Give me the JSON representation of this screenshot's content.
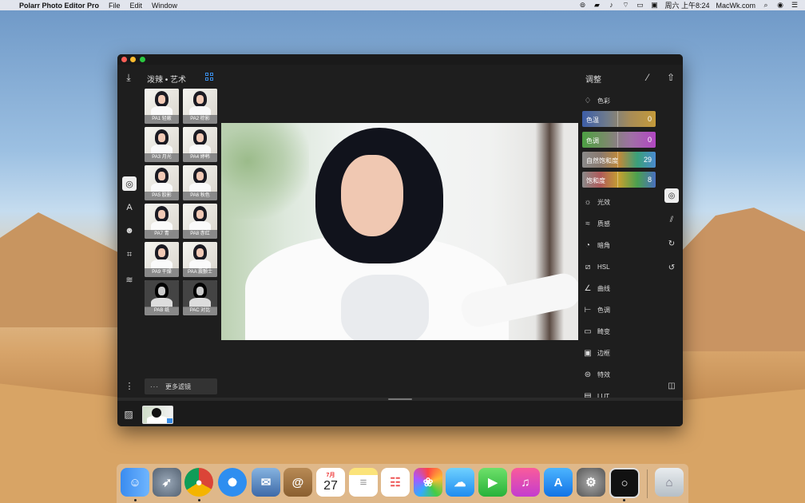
{
  "menubar": {
    "app_name": "Polarr Photo Editor Pro",
    "menus": [
      "File",
      "Edit",
      "Window"
    ],
    "clock": "周六 上午8:24",
    "site": "MacWk.com"
  },
  "toolbar": {
    "section_title": "泼辣 • 艺术",
    "adjust_title": "调整"
  },
  "filters": [
    {
      "label": "PA1 轻蔽"
    },
    {
      "label": "PA2 棕影"
    },
    {
      "label": "PA3 月光"
    },
    {
      "label": "PA4 婷韩"
    },
    {
      "label": "PA5 胶影"
    },
    {
      "label": "PA6 秋色"
    },
    {
      "label": "PA7 青"
    },
    {
      "label": "PA8 赤红"
    },
    {
      "label": "PA9 干燥"
    },
    {
      "label": "PAA 震颤士"
    },
    {
      "label": "PAB 纸"
    },
    {
      "label": "PAC 对比"
    }
  ],
  "more_filters": "更多滤镜",
  "adjust": {
    "color_section": "色彩",
    "sliders": [
      {
        "name": "色温",
        "value": "0"
      },
      {
        "name": "色调",
        "value": "0"
      },
      {
        "name": "自然饱和度",
        "value": "29"
      },
      {
        "name": "饱和度",
        "value": "8"
      }
    ],
    "categories": [
      {
        "label": "光效"
      },
      {
        "label": "质感"
      },
      {
        "label": "暗角"
      },
      {
        "label": "HSL"
      },
      {
        "label": "曲线"
      },
      {
        "label": "色调"
      },
      {
        "label": "畸变"
      },
      {
        "label": "边框"
      },
      {
        "label": "特效"
      },
      {
        "label": "LUT"
      }
    ]
  },
  "dock": {
    "calendar_month": "7月",
    "calendar_day": "27"
  },
  "colors": {
    "accent": "#3a8ee6",
    "window_bg": "#1e1e1e"
  }
}
